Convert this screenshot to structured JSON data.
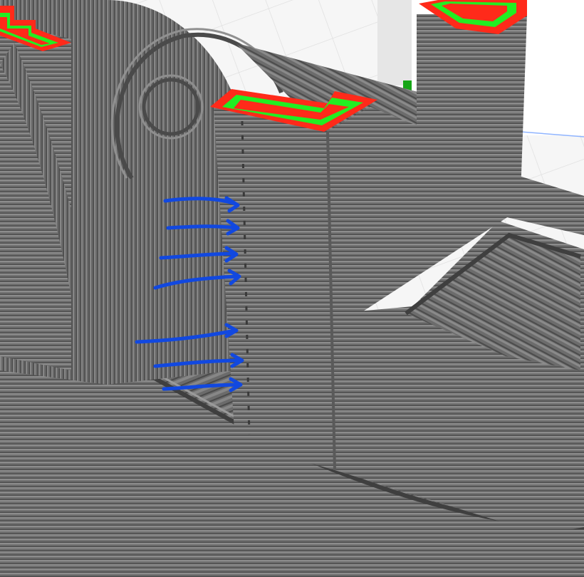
{
  "viewport": {
    "colors": {
      "background": "#f4f4f4",
      "grid_line": "#e2e2e2",
      "axis_line": "#8fb4ff",
      "plate_edge": "#d0d0d0",
      "model_body": "#6e6e6e",
      "model_dark": "#4a4a4a",
      "model_light": "#8c8c8c",
      "outer_wall": "#ff2a1a",
      "inner_wall": "#22ee22",
      "travel_marker": "#16a616",
      "annotation": "#1148e0"
    },
    "annotation": {
      "icon": "blue-arrow-annotation-icon",
      "arrow_count": 7
    }
  }
}
